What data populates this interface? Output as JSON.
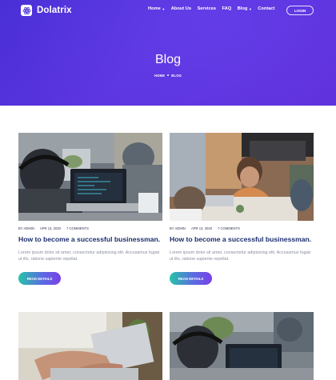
{
  "brand": {
    "name": "Dolatrix"
  },
  "nav": {
    "items": [
      {
        "label": "Home",
        "caret": true
      },
      {
        "label": "About Us",
        "caret": false
      },
      {
        "label": "Services",
        "caret": false
      },
      {
        "label": "FAQ",
        "caret": false
      },
      {
        "label": "Blog",
        "caret": true
      },
      {
        "label": "Contact",
        "caret": false
      }
    ],
    "login_label": "LOGIN"
  },
  "hero": {
    "title": "Blog",
    "breadcrumb": [
      "HOME",
      "BLOG"
    ]
  },
  "posts": [
    {
      "author": "BY ADMIN",
      "date": "APR 13, 2020",
      "comments": "7 COMMENTS",
      "title": "How to become a successful businessman.",
      "excerpt": "Lorem ipsum dolor sit amet, consectetur adipisicing elit. Accusamus fugiat ut illo, ratione sapiente repellat.",
      "button": "READ DETAILS"
    },
    {
      "author": "BY ADMIN",
      "date": "APR 13, 2020",
      "comments": "7 COMMENTS",
      "title": "How to become a successful businessman.",
      "excerpt": "Lorem ipsum dolor sit amet, consectetur adipisicing elit. Accusamus fugiat ut illo, ratione sapiente repellat.",
      "button": "READ DETAILS"
    }
  ],
  "colors": {
    "hero": "#4f31db",
    "title": "#1c2e6e",
    "button_start": "#27c3a8",
    "button_end": "#7a3fe8"
  }
}
